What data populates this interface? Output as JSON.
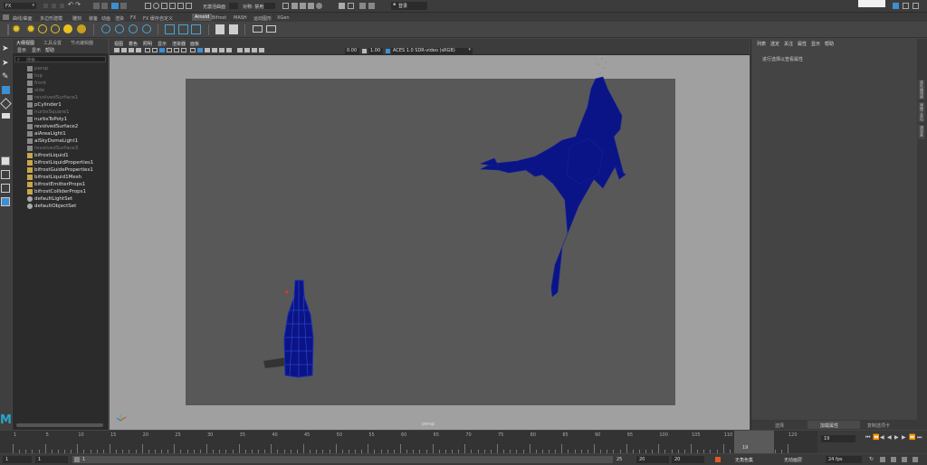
{
  "top_bar": {
    "mode_value": "FX",
    "no_live_surface": "无激活曲面",
    "symmetry": "对称: 禁用",
    "login": "登录"
  },
  "shelf_tabs": [
    "曲线/曲面",
    "多边形建模",
    "雕刻",
    "装备",
    "动画",
    "渲染",
    "FX",
    "FX 缓存",
    "自定义",
    "Arnold",
    "Bifrost",
    "MASH",
    "运动图形",
    "XGen"
  ],
  "shelf_active_tab": "Arnold",
  "outliner": {
    "tabs": [
      "大纲视图",
      "工具设置",
      "节点编辑器"
    ],
    "menu": [
      "显示",
      "显示",
      "帮助"
    ],
    "search_placeholder": "搜索...",
    "items": [
      {
        "label": "persp",
        "dim": true
      },
      {
        "label": "top",
        "dim": true
      },
      {
        "label": "front",
        "dim": true
      },
      {
        "label": "side",
        "dim": true
      },
      {
        "label": "revolvedSurface1",
        "dim": true
      },
      {
        "label": "pCylinder1",
        "dim": false
      },
      {
        "label": "nurbsSquare1",
        "dim": true
      },
      {
        "label": "nurbsToPoly1",
        "dim": false
      },
      {
        "label": "revolvedSurface2",
        "dim": false
      },
      {
        "label": "aiAreaLight1",
        "dim": false
      },
      {
        "label": "aiSkyDomeLight1",
        "dim": false
      },
      {
        "label": "revolvedSurface3",
        "dim": true
      },
      {
        "label": "bifrostLiquid1",
        "dim": false
      },
      {
        "label": "bifrostLiquidProperties1",
        "dim": false
      },
      {
        "label": "bifrostGuideProperties1",
        "dim": false
      },
      {
        "label": "bifrostLiquid1Mesh",
        "dim": false
      },
      {
        "label": "bifrostEmitterProps1",
        "dim": false
      },
      {
        "label": "bifrostColliderProps1",
        "dim": false
      },
      {
        "label": "defaultLightSet",
        "dim": false
      },
      {
        "label": "defaultObjectSet",
        "dim": false
      }
    ]
  },
  "viewport": {
    "menu": [
      "视图",
      "着色",
      "照明",
      "显示",
      "渲染器",
      "面板"
    ],
    "field_a": "0.00",
    "field_b": "1.00",
    "color_space": "ACES 1.0 SDR-video (sRGB)",
    "camera_label": "persp"
  },
  "attribute_editor": {
    "menu": [
      "列表",
      "选定",
      "关注",
      "属性",
      "显示",
      "帮助"
    ],
    "message": "进行选择以查看属性",
    "bottom_tabs": [
      "选择",
      "加载属性",
      "复制选项卡"
    ],
    "side_tabs": [
      "属性编辑器",
      "建模工具包",
      "通道盒"
    ]
  },
  "timeline": {
    "ticks": [
      "1",
      "5",
      "10",
      "15",
      "20",
      "25",
      "30",
      "35",
      "40",
      "45",
      "50",
      "55",
      "60",
      "65",
      "70",
      "75",
      "80",
      "85",
      "90",
      "95",
      "100",
      "105",
      "110",
      "115",
      "120"
    ],
    "current_marker": "19",
    "current_frame_field": "19"
  },
  "range_bar": {
    "start_field": "1",
    "start_field2": "1",
    "range_start_label": "1",
    "end_a": "25",
    "end_b": "20",
    "end_c": "20",
    "no_character_set": "无角色集",
    "no_anim_layer": "无动画层",
    "fps": "24 fps"
  },
  "colors": {
    "accent": "#3d8fd1",
    "viewport_bg": "#a0a0a0",
    "render_region": "#585858",
    "wireframe": "#0a1486"
  }
}
